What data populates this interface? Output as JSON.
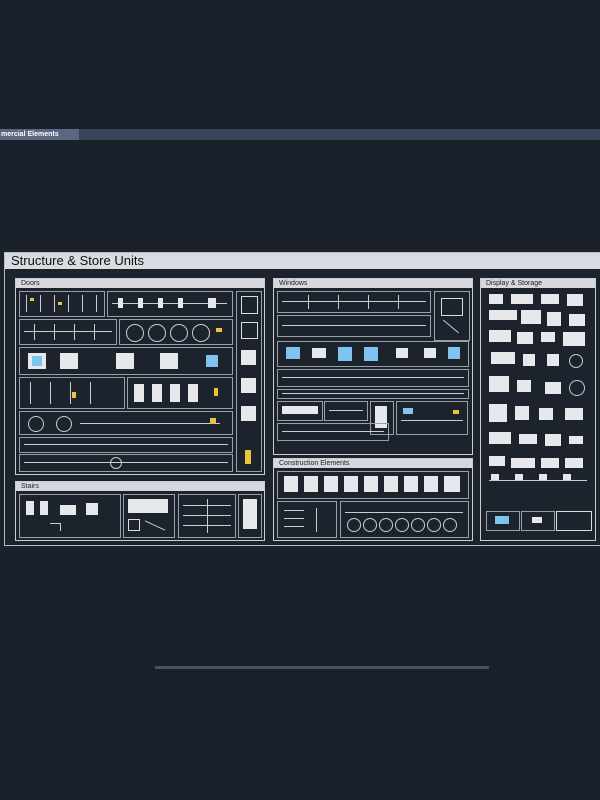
{
  "tab": {
    "label": "mercial Elements"
  },
  "sheet": {
    "title": "Structure & Store Units",
    "panels": {
      "doors": "Doors",
      "windows": "Windows",
      "display": "Display & Storage",
      "stairs": "Stairs",
      "construction": "Construction Elements"
    }
  },
  "colors": {
    "background": "#1b212b",
    "tabbar": "#3a4458",
    "title_bar": "#d9dbe0",
    "accent_yellow": "#e8c53a",
    "accent_cyan": "#7fc4f0"
  }
}
